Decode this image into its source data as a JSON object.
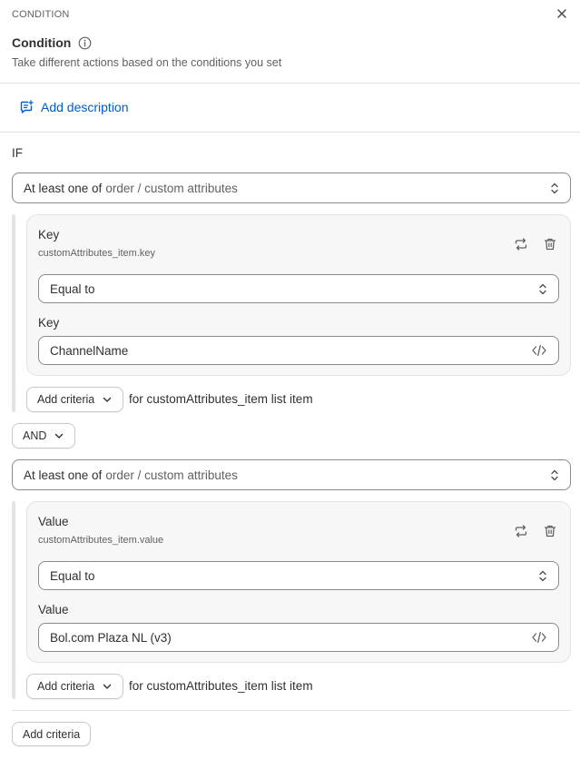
{
  "header": {
    "eyebrow": "CONDITION",
    "title": "Condition",
    "subtitle": "Take different actions based on the conditions you set"
  },
  "add_description": {
    "label": "Add description"
  },
  "if_label": "IF",
  "groups": [
    {
      "quantifier": "At least one of",
      "scope": "order / custom attributes",
      "card": {
        "title": "Key",
        "path": "customAttributes_item.key",
        "operator": "Equal to",
        "field_label": "Key",
        "value": "ChannelName"
      },
      "add_criteria_label": "Add criteria",
      "for_text": "for customAttributes_item list item"
    },
    {
      "quantifier": "At least one of",
      "scope": "order / custom attributes",
      "card": {
        "title": "Value",
        "path": "customAttributes_item.value",
        "operator": "Equal to",
        "field_label": "Value",
        "value": "Bol.com Plaza NL (v3)"
      },
      "add_criteria_label": "Add criteria",
      "for_text": "for customAttributes_item list item"
    }
  ],
  "connector": {
    "label": "AND"
  },
  "footer": {
    "add_criteria_label": "Add criteria"
  },
  "colors": {
    "link": "#005bd3",
    "text": "#303030",
    "muted": "#616161",
    "border": "#8a8a8a"
  }
}
